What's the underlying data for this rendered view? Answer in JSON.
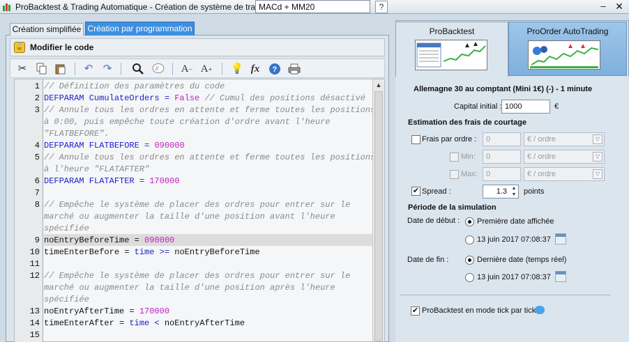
{
  "window": {
    "title": "ProBacktest & Trading Automatique - Création de système de trading",
    "system_name": "MACd + MM20",
    "help_label": "?",
    "minimize_label": "–",
    "close_label": "✕"
  },
  "left": {
    "tabs": [
      "Création simplifiée",
      "Création par programmation"
    ],
    "modify_code_label": "Modifier le code",
    "toolbar_icons": [
      "cut-icon",
      "copy-icon",
      "paste-icon",
      "undo-icon",
      "redo-icon",
      "search-icon",
      "comment-icon",
      "font-decrease-icon",
      "font-increase-icon",
      "tip-icon",
      "function-icon",
      "help-icon",
      "print-icon"
    ]
  },
  "editor": {
    "lines": [
      {
        "n": "1",
        "parts": [
          {
            "t": "// Définition des paramètres du code",
            "c": "cm"
          }
        ]
      },
      {
        "n": "2",
        "parts": [
          {
            "t": "DEFPARAM CumulateOrders = ",
            "c": "kw"
          },
          {
            "t": "False",
            "c": "num"
          },
          {
            "t": " // Cumul des positions désactivé",
            "c": "cm"
          }
        ]
      },
      {
        "n": "3",
        "parts": [
          {
            "t": "// Annule tous les ordres en attente et ferme toutes les positions",
            "c": "cm"
          }
        ]
      },
      {
        "n": "",
        "parts": [
          {
            "t": "à 0:00, puis empêche toute création d'ordre avant l'heure",
            "c": "cm"
          }
        ]
      },
      {
        "n": "",
        "parts": [
          {
            "t": "\"FLATBEFORE\".",
            "c": "cm"
          }
        ]
      },
      {
        "n": "4",
        "parts": [
          {
            "t": "DEFPARAM FLATBEFORE = ",
            "c": "kw"
          },
          {
            "t": "090000",
            "c": "num"
          }
        ]
      },
      {
        "n": "5",
        "parts": [
          {
            "t": "// Annule tous les ordres en attente et ferme toutes les positions",
            "c": "cm"
          }
        ]
      },
      {
        "n": "",
        "parts": [
          {
            "t": "à l'heure \"FLATAFTER\"",
            "c": "cm"
          }
        ]
      },
      {
        "n": "6",
        "parts": [
          {
            "t": "DEFPARAM FLATAFTER = ",
            "c": "kw"
          },
          {
            "t": "170000",
            "c": "num"
          }
        ]
      },
      {
        "n": "7",
        "parts": []
      },
      {
        "n": "8",
        "parts": [
          {
            "t": "// Empêche le système de placer des ordres pour entrer sur le",
            "c": "cm"
          }
        ]
      },
      {
        "n": "",
        "parts": [
          {
            "t": "marché ou augmenter la taille d'une position avant l'heure",
            "c": "cm"
          }
        ]
      },
      {
        "n": "",
        "parts": [
          {
            "t": "spécifiée",
            "c": "cm"
          }
        ]
      },
      {
        "n": "9",
        "parts": [
          {
            "t": "noEntryBeforeTime = ",
            "c": ""
          },
          {
            "t": "090000",
            "c": "num"
          }
        ]
      },
      {
        "n": "10",
        "parts": [
          {
            "t": "timeEnterBefore = ",
            "c": ""
          },
          {
            "t": "time",
            "c": "kw"
          },
          {
            "t": " >= ",
            "c": "kw"
          },
          {
            "t": "noEntryBeforeTime",
            "c": ""
          }
        ]
      },
      {
        "n": "11",
        "parts": []
      },
      {
        "n": "12",
        "parts": [
          {
            "t": "// Empêche le système de placer des ordres pour entrer sur le",
            "c": "cm"
          }
        ]
      },
      {
        "n": "",
        "parts": [
          {
            "t": "marché ou augmenter la taille d'une position après l'heure",
            "c": "cm"
          }
        ]
      },
      {
        "n": "",
        "parts": [
          {
            "t": "spécifiée",
            "c": "cm"
          }
        ]
      },
      {
        "n": "13",
        "parts": [
          {
            "t": "noEntryAfterTime = ",
            "c": ""
          },
          {
            "t": "170000",
            "c": "num"
          }
        ]
      },
      {
        "n": "14",
        "parts": [
          {
            "t": "timeEnterAfter = ",
            "c": ""
          },
          {
            "t": "time",
            "c": "kw"
          },
          {
            "t": " < ",
            "c": "kw"
          },
          {
            "t": "noEntryAfterTime",
            "c": ""
          }
        ]
      },
      {
        "n": "15",
        "parts": []
      }
    ]
  },
  "right": {
    "tabs": [
      "ProBacktest",
      "ProOrder AutoTrading"
    ],
    "instrument": "Allemagne 30 au comptant (Mini 1€) (-) - 1 minute",
    "capital_label": "Capital initial :",
    "capital_value": "1000",
    "capital_currency": "€",
    "fees_heading": "Estimation des frais de courtage",
    "fees": {
      "per_order_label": "Frais par ordre :",
      "min_label": "Min:",
      "max_label": "Max:",
      "value": "0",
      "unit": "€ / ordre"
    },
    "spread_label": "Spread :",
    "spread_value": "1.3",
    "spread_unit": "points",
    "period_heading": "Période de la simulation",
    "start_label": "Date de début :",
    "start_option1": "Première date affichée",
    "start_option2": "13 juin 2017 07:08:37",
    "end_label": "Date de fin :",
    "end_option1": "Dernière date (temps réel)",
    "end_option2": "13 juin 2017 07:08:37",
    "tick_mode_label": "ProBacktest en mode tick par tick"
  }
}
